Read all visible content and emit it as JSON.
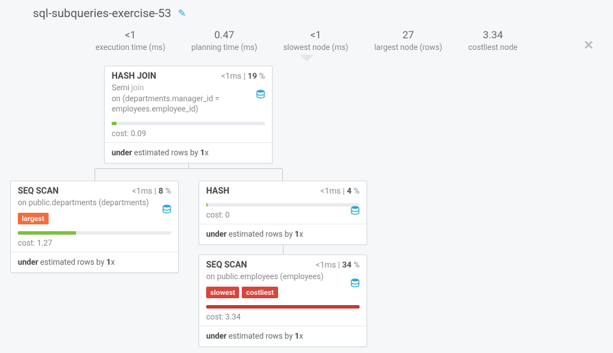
{
  "title": "sql-subqueries-exercise-53",
  "stats": [
    {
      "value": "<1",
      "label": "execution time (ms)"
    },
    {
      "value": "0.47",
      "label": "planning time (ms)"
    },
    {
      "value": "<1",
      "label": "slowest node (ms)"
    },
    {
      "value": "27",
      "label": "largest node (rows)"
    },
    {
      "value": "3.34",
      "label": "costliest node"
    }
  ],
  "nodes": {
    "hash_join": {
      "op": "HASH JOIN",
      "time": "<1",
      "pct": "19",
      "sub_prefix": "Semi",
      "sub_dim": "join",
      "sub_on": "on (departments.manager_id = employees.employee_id)",
      "bar_pct": 3,
      "bar_color": "green",
      "cost": "cost: 0.09",
      "est_prefix": "under",
      "est_mid": " estimated rows by ",
      "est_factor": "1",
      "est_suffix": "x"
    },
    "seq_departments": {
      "op": "SEQ SCAN",
      "time": "<1",
      "pct": "8",
      "sub": "on public.departments (departments)",
      "badges": [
        {
          "text": "largest",
          "cls": "orange"
        }
      ],
      "bar_pct": 38,
      "bar_color": "green",
      "cost": "cost: 1.27",
      "est_prefix": "under",
      "est_mid": " estimated rows by ",
      "est_factor": "1",
      "est_suffix": "x"
    },
    "hash": {
      "op": "HASH",
      "time": "<1",
      "pct": "4",
      "bar_pct": 1,
      "bar_color": "green",
      "cost": "cost: 0",
      "est_prefix": "under",
      "est_mid": " estimated rows by ",
      "est_factor": "1",
      "est_suffix": "x"
    },
    "seq_employees": {
      "op": "SEQ SCAN",
      "time": "<1",
      "pct": "34",
      "sub": "on public.employees (employees)",
      "badges": [
        {
          "text": "slowest",
          "cls": "red"
        },
        {
          "text": "costliest",
          "cls": "red"
        }
      ],
      "bar_pct": 100,
      "bar_color": "red",
      "cost": "cost: 3.34",
      "est_prefix": "under",
      "est_mid": " estimated rows by ",
      "est_factor": "1",
      "est_suffix": "x"
    }
  }
}
